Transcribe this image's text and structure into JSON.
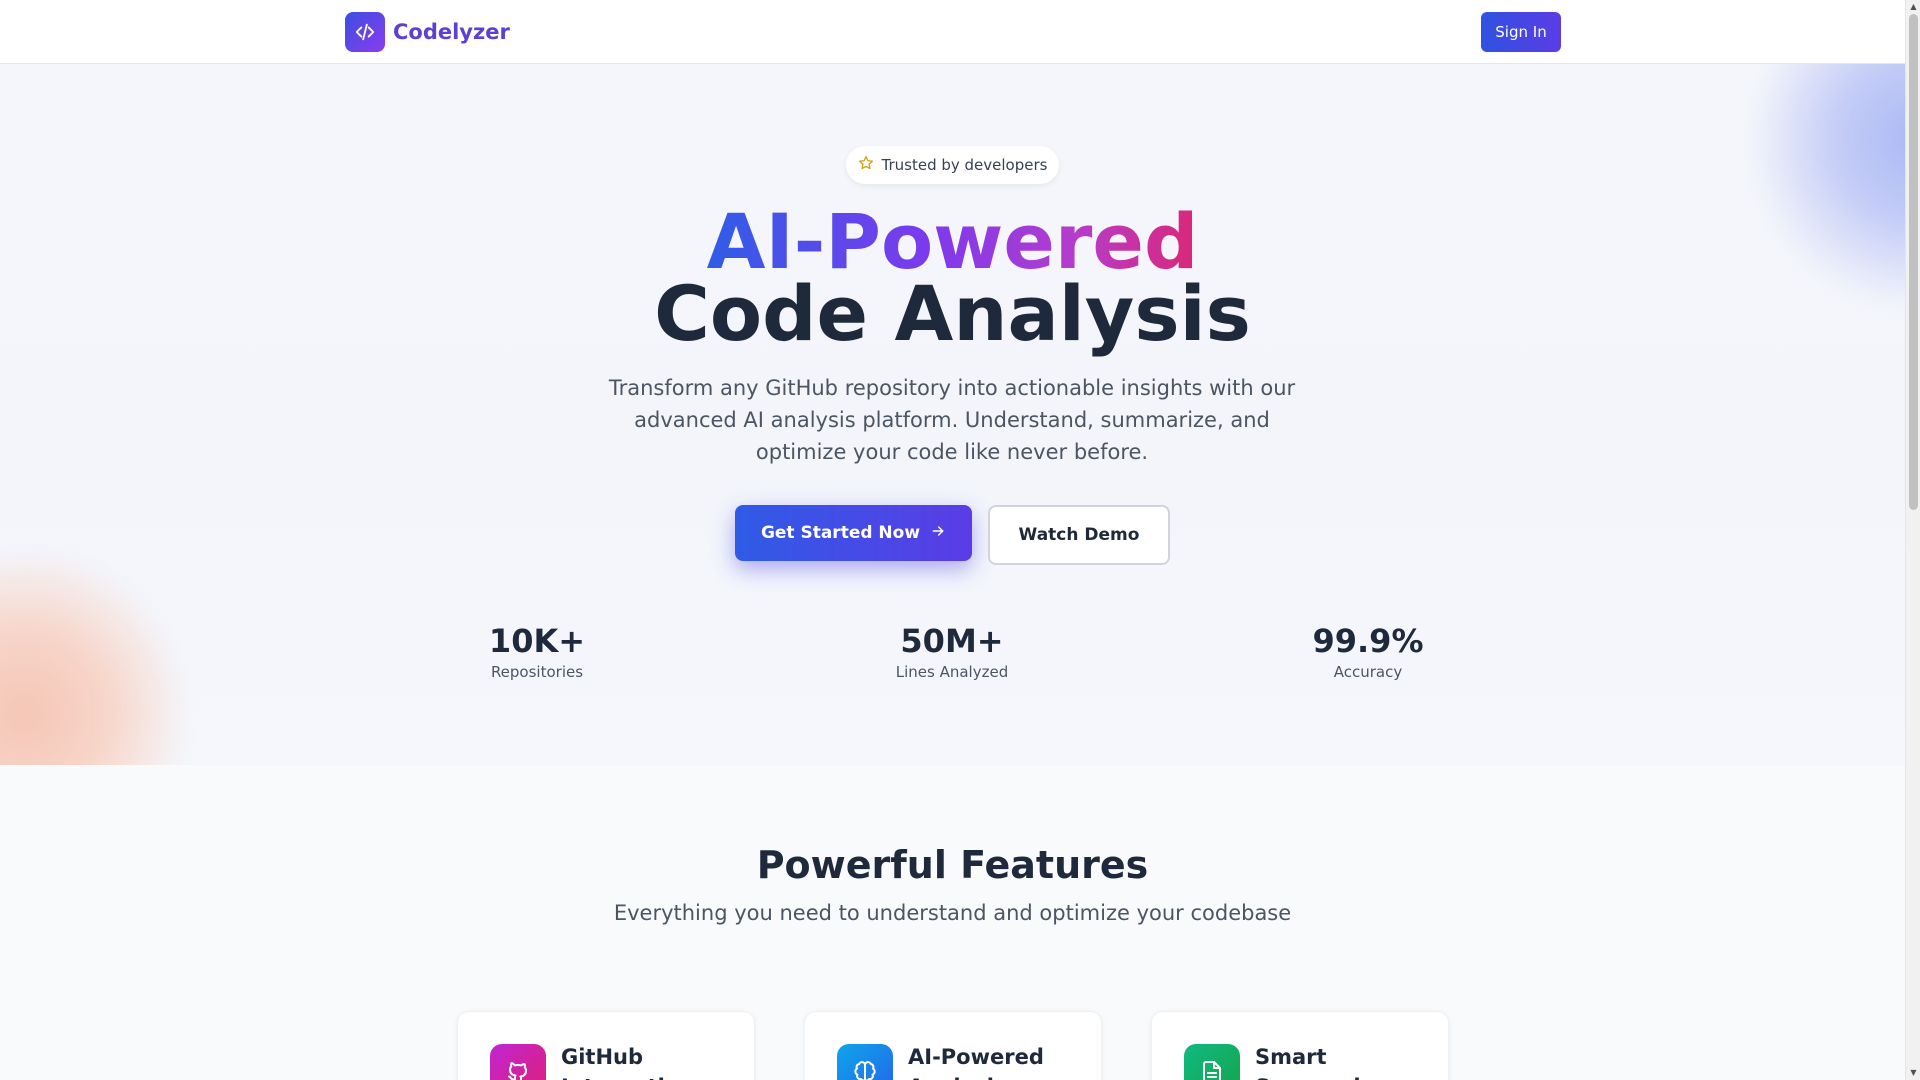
{
  "header": {
    "brand_name": "Codelyzer",
    "brand_icon": "code-icon",
    "signin_label": "Sign In"
  },
  "hero": {
    "badge_text": "Trusted by developers",
    "badge_icon": "star-icon",
    "title_line1": "AI-Powered",
    "title_line2": "Code Analysis",
    "subtitle": "Transform any GitHub repository into actionable insights with our advanced AI analysis platform. Understand, summarize, and optimize your code like never before.",
    "primary_cta": "Get Started Now",
    "primary_cta_icon": "arrow-right-icon",
    "secondary_cta": "Watch Demo",
    "stats": [
      {
        "value": "10K+",
        "label": "Repositories"
      },
      {
        "value": "50M+",
        "label": "Lines Analyzed"
      },
      {
        "value": "99.9%",
        "label": "Accuracy"
      }
    ]
  },
  "features": {
    "title": "Powerful Features",
    "subtitle": "Everything you need to understand and optimize your codebase",
    "cards": [
      {
        "title": "GitHub Integration",
        "icon": "github-icon",
        "color": "#c026d3"
      },
      {
        "title": "AI-Powered Analysis",
        "icon": "brain-icon",
        "color": "#0ea5e9"
      },
      {
        "title": "Smart Summaries",
        "icon": "document-icon",
        "color": "#10b981"
      }
    ]
  },
  "colors": {
    "accent_blue": "#2f5be6",
    "accent_purple": "#5b3ce6",
    "accent_pink": "#db2777"
  }
}
